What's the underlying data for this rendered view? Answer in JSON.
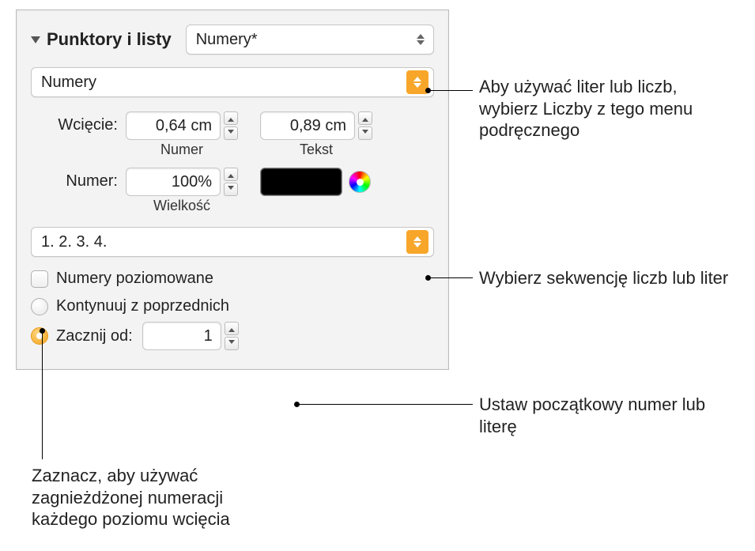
{
  "header": {
    "section_label": "Punktory i listy",
    "style_popup": "Numery*"
  },
  "type_popup": "Numery",
  "indent": {
    "label": "Wcięcie:",
    "number_value": "0,64 cm",
    "number_caption": "Numer",
    "text_value": "0,89 cm",
    "text_caption": "Tekst"
  },
  "number": {
    "label": "Numer:",
    "size_value": "100%",
    "size_caption": "Wielkość"
  },
  "sequence_popup": "1. 2. 3. 4.",
  "tiered_checkbox_label": "Numery poziomowane",
  "continue_radio_label": "Kontynuuj z poprzednich",
  "startfrom": {
    "radio_label": "Zacznij od:",
    "value": "1"
  },
  "callouts": {
    "type": "Aby używać liter lub liczb, wybierz Liczby z tego menu podręcznego",
    "sequence": "Wybierz sekwencję liczb lub liter",
    "start": "Ustaw początkowy numer lub literę",
    "tiered": "Zaznacz, aby używać zagnieżdżonej numeracji każdego poziomu wcięcia"
  }
}
